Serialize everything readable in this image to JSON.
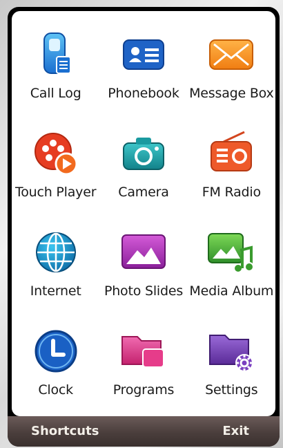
{
  "apps": [
    {
      "label": "Call Log",
      "icon": "call-log-icon"
    },
    {
      "label": "Phonebook",
      "icon": "phonebook-icon"
    },
    {
      "label": "Message Box",
      "icon": "message-box-icon"
    },
    {
      "label": "Touch Player",
      "icon": "touch-player-icon"
    },
    {
      "label": "Camera",
      "icon": "camera-icon"
    },
    {
      "label": "FM Radio",
      "icon": "fm-radio-icon"
    },
    {
      "label": "Internet",
      "icon": "internet-globe-icon"
    },
    {
      "label": "Photo Slides",
      "icon": "photo-slides-icon"
    },
    {
      "label": "Media Album",
      "icon": "media-album-icon"
    },
    {
      "label": "Clock",
      "icon": "clock-icon"
    },
    {
      "label": "Programs",
      "icon": "programs-folder-icon"
    },
    {
      "label": "Settings",
      "icon": "settings-folder-icon"
    }
  ],
  "softkeys": {
    "left": "Shortcuts",
    "right": "Exit"
  },
  "colors": {
    "softbar": "#4a3e3c",
    "softkey_text": "#f3efe8",
    "screen": "#ffffff"
  }
}
